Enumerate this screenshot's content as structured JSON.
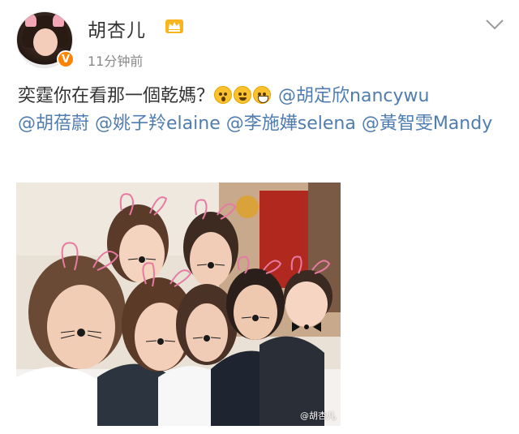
{
  "post": {
    "username": "胡杏儿",
    "timestamp": "11分钟前",
    "verified_badge": "V",
    "text_main": "奕霆你在看那一個乾媽？",
    "emojis": [
      "wow-emoji",
      "worried-emoji",
      "laugh-emoji"
    ],
    "mentions": [
      "@胡定欣nancywu",
      "@胡蓓蔚",
      "@姚子羚elaine",
      "@李施嬅selena",
      "@黃智雯Mandy"
    ],
    "photo_watermark": "@胡杏儿"
  },
  "icons": {
    "crown": "crown-member-icon",
    "menu": "chevron-down-icon"
  },
  "colors": {
    "mention": "#507daf",
    "username": "#333333",
    "timestamp": "#888888",
    "verified": "#ff8200"
  }
}
